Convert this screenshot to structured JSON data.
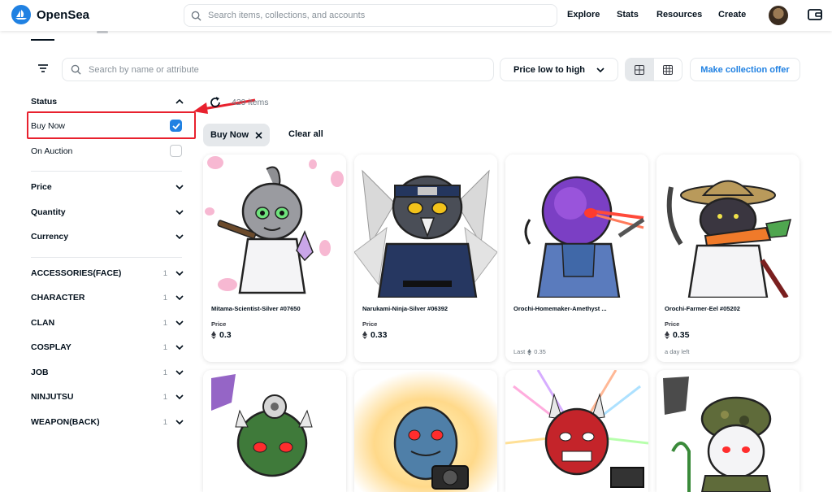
{
  "header": {
    "brand": "OpenSea",
    "search_placeholder": "Search items, collections, and accounts",
    "nav": [
      "Explore",
      "Stats",
      "Resources",
      "Create"
    ]
  },
  "toolbar": {
    "search_placeholder": "Search by name or attribute",
    "sort_label": "Price low to high",
    "offer_label": "Make collection offer"
  },
  "sidebar": {
    "status_title": "Status",
    "status_options": [
      {
        "label": "Buy Now",
        "checked": true
      },
      {
        "label": "On Auction",
        "checked": false
      }
    ],
    "filters": [
      "Price",
      "Quantity",
      "Currency"
    ],
    "traits": [
      {
        "label": "ACCESSORIES(FACE)",
        "count": "1"
      },
      {
        "label": "CHARACTER",
        "count": "1"
      },
      {
        "label": "CLAN",
        "count": "1"
      },
      {
        "label": "COSPLAY",
        "count": "1"
      },
      {
        "label": "JOB",
        "count": "1"
      },
      {
        "label": "NINJUTSU",
        "count": "1"
      },
      {
        "label": "WEAPON(BACK)",
        "count": "1"
      }
    ]
  },
  "results": {
    "count": "429 items",
    "chip_label": "Buy Now",
    "clear_label": "Clear all"
  },
  "cards": [
    {
      "name": "Mitama-Scientist-Silver #07650",
      "price_label": "Price",
      "price": "0.3",
      "foot": ""
    },
    {
      "name": "Narukami-Ninja-Silver #06392",
      "price_label": "Price",
      "price": "0.33",
      "foot": ""
    },
    {
      "name": "Orochi-Homemaker-Amethyst ...",
      "price_label": "",
      "price": "",
      "foot": "Last",
      "foot_value": "0.35"
    },
    {
      "name": "Orochi-Farmer-Eel #05202",
      "price_label": "Price",
      "price": "0.35",
      "foot": "a day left"
    }
  ],
  "colors": {
    "accent": "#2081e2",
    "highlight": "#e8212e"
  }
}
